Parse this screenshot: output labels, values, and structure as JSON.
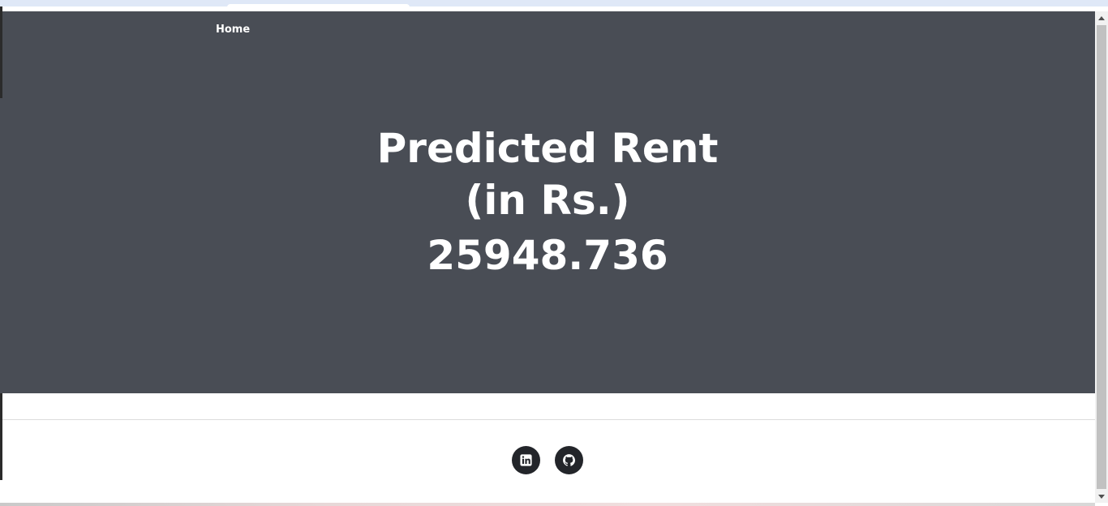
{
  "navbar": {
    "home_label": "Home"
  },
  "hero": {
    "title_line1": "Predicted Rent",
    "title_line2": "(in Rs.)",
    "predicted_value": "25948.736"
  },
  "footer": {
    "social_links": [
      {
        "icon": "linkedin-icon"
      },
      {
        "icon": "github-icon"
      }
    ]
  },
  "colors": {
    "hero_background": "#494d55",
    "text": "#ffffff",
    "social_button": "#23252a"
  }
}
